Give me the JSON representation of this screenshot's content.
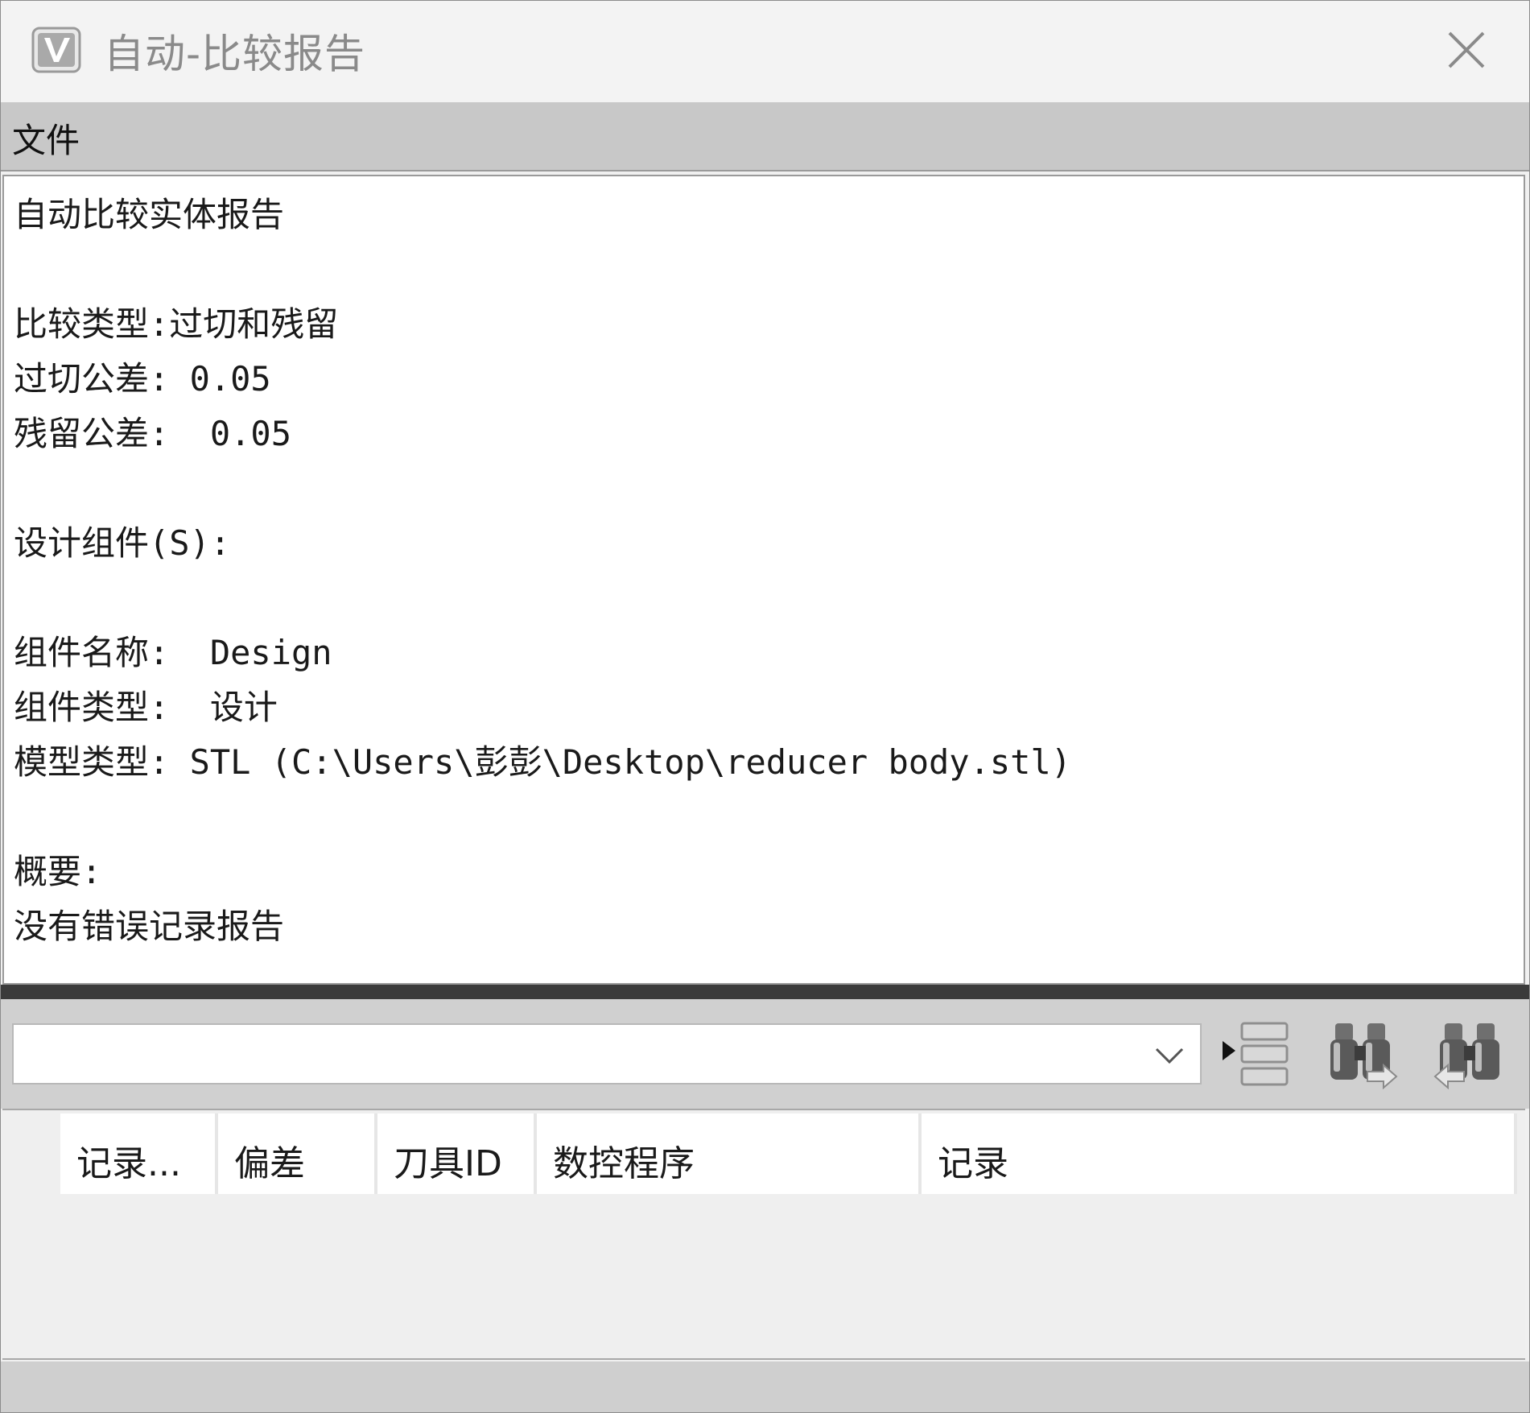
{
  "window": {
    "title": "自动-比较报告",
    "icon": "vericut-app-icon",
    "close_icon": "close-icon"
  },
  "menu": {
    "items": [
      {
        "label": "文件"
      }
    ]
  },
  "report": {
    "lines": [
      "自动比较实体报告",
      "",
      "比较类型:过切和残留",
      "过切公差: 0.05",
      "残留公差:  0.05",
      "",
      "设计组件(S):",
      "",
      "组件名称:  Design",
      "组件类型:  设计",
      "模型类型: STL (C:\\Users\\彭彭\\Desktop\\reducer body.stl)",
      "",
      "概要:",
      "没有错误记录报告"
    ]
  },
  "toolbar": {
    "combo_value": "",
    "buttons": [
      {
        "name": "record-list-icon"
      },
      {
        "name": "find-next-binoculars-icon"
      },
      {
        "name": "find-previous-binoculars-icon"
      }
    ]
  },
  "grid": {
    "columns": [
      {
        "label": "记录..."
      },
      {
        "label": "偏差"
      },
      {
        "label": "刀具ID"
      },
      {
        "label": "数控程序"
      },
      {
        "label": "记录"
      }
    ],
    "rows": []
  }
}
